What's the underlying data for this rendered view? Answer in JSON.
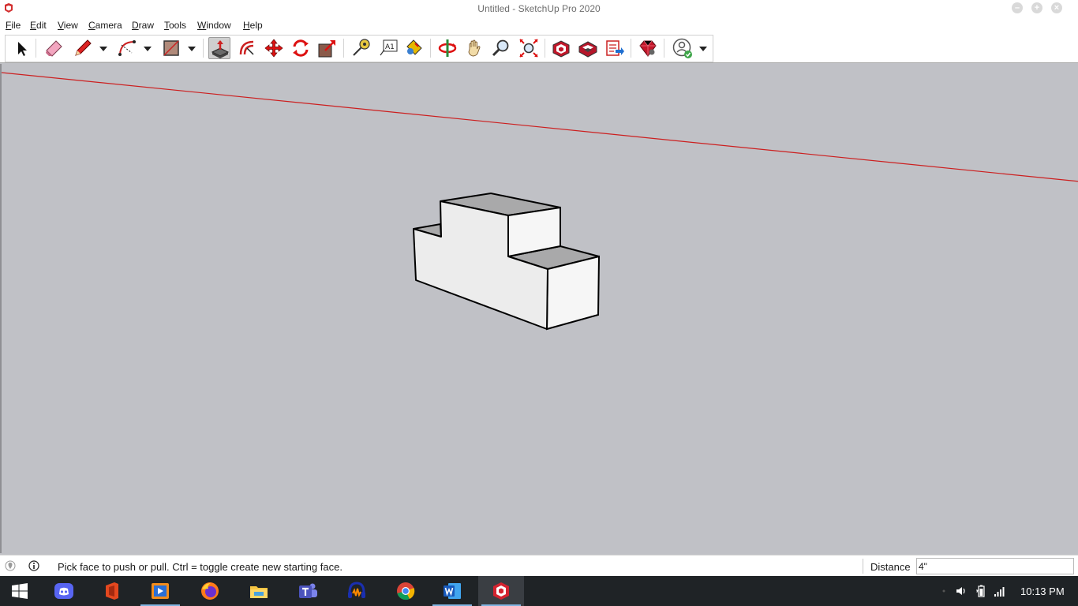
{
  "window": {
    "title": "Untitled - SketchUp Pro 2020",
    "controls": {
      "minimize": "–",
      "maximize": "+",
      "close": "×"
    }
  },
  "menu": [
    "File",
    "Edit",
    "View",
    "Camera",
    "Draw",
    "Tools",
    "Window",
    "Help"
  ],
  "toolbar": {
    "tools": [
      {
        "name": "select-tool",
        "icon": "arrow-cursor-icon"
      },
      {
        "name": "eraser-tool",
        "icon": "eraser-icon"
      },
      {
        "name": "line-tool",
        "icon": "pencil-icon"
      },
      {
        "name": "arc-tool",
        "icon": "arc-icon"
      },
      {
        "name": "rectangle-tool",
        "icon": "rectangle-icon"
      },
      {
        "name": "push-pull-tool",
        "icon": "push-pull-icon",
        "active": true
      },
      {
        "name": "offset-tool",
        "icon": "offset-icon"
      },
      {
        "name": "move-tool",
        "icon": "move-arrows-icon"
      },
      {
        "name": "rotate-tool",
        "icon": "rotate-icon"
      },
      {
        "name": "scale-tool",
        "icon": "scale-icon"
      },
      {
        "name": "tape-measure-tool",
        "icon": "tape-measure-icon"
      },
      {
        "name": "text-tool",
        "icon": "text-label-icon",
        "text": "A1"
      },
      {
        "name": "paint-bucket-tool",
        "icon": "paint-bucket-icon"
      },
      {
        "name": "orbit-tool",
        "icon": "orbit-icon"
      },
      {
        "name": "pan-tool",
        "icon": "hand-icon"
      },
      {
        "name": "zoom-tool",
        "icon": "magnifier-icon"
      },
      {
        "name": "zoom-extents-tool",
        "icon": "zoom-extents-icon"
      },
      {
        "name": "3d-warehouse",
        "icon": "warehouse-icon"
      },
      {
        "name": "extension-warehouse",
        "icon": "extension-warehouse-icon"
      },
      {
        "name": "send-to-layout",
        "icon": "layout-icon"
      },
      {
        "name": "extension-manager",
        "icon": "ruby-gem-icon"
      },
      {
        "name": "account",
        "icon": "user-account-icon"
      }
    ]
  },
  "status": {
    "message": "Pick face to push or pull.  Ctrl = toggle create new starting face.",
    "measurement_label": "Distance",
    "measurement_value": "4\""
  },
  "taskbar": {
    "apps": [
      {
        "name": "windows-start",
        "icon": "windows-logo-icon"
      },
      {
        "name": "discord",
        "icon": "discord-icon"
      },
      {
        "name": "office",
        "icon": "office-icon"
      },
      {
        "name": "video-player",
        "icon": "video-player-icon"
      },
      {
        "name": "firefox",
        "icon": "firefox-icon"
      },
      {
        "name": "file-explorer",
        "icon": "folder-icon"
      },
      {
        "name": "teams",
        "icon": "teams-icon"
      },
      {
        "name": "audacity",
        "icon": "audacity-icon"
      },
      {
        "name": "chrome",
        "icon": "chrome-icon"
      },
      {
        "name": "word",
        "icon": "word-icon"
      },
      {
        "name": "sketchup",
        "icon": "sketchup-icon"
      }
    ],
    "clock": "10:13 PM"
  },
  "colors": {
    "viewport": "#c0c1c6",
    "red_axis": "#cc1f1f",
    "face_light": "#ececec",
    "face_mid": "#f6f6f6",
    "face_top": "#a9a9aa",
    "taskbar": "#1f2326"
  }
}
